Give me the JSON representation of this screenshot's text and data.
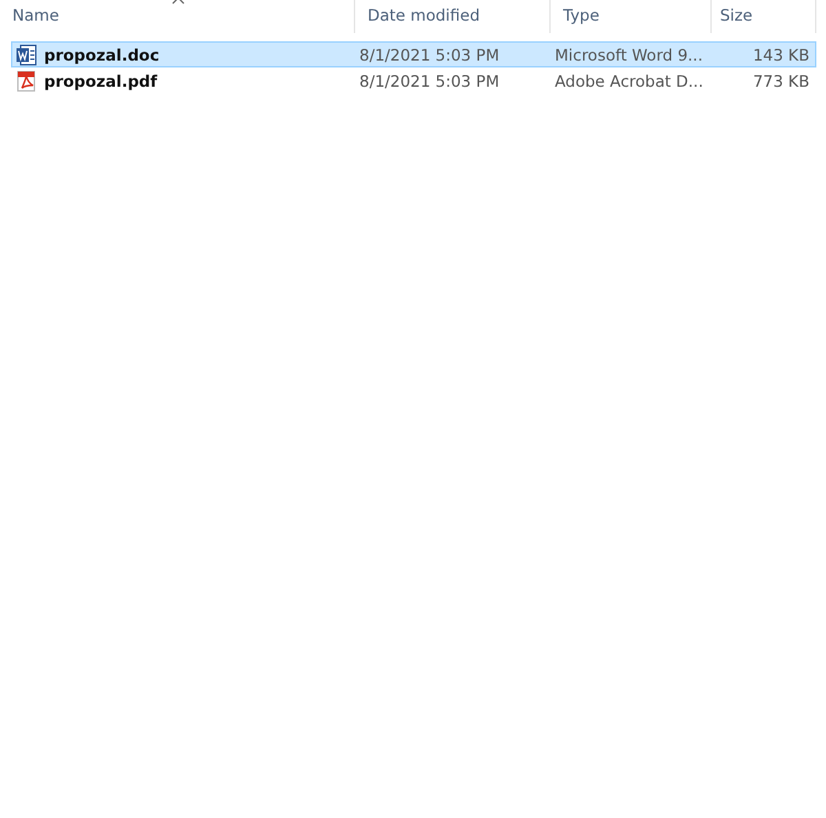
{
  "columns": [
    {
      "label": "Name",
      "sorted": true
    },
    {
      "label": "Date modified",
      "sorted": false
    },
    {
      "label": "Type",
      "sorted": false
    },
    {
      "label": "Size",
      "sorted": false
    }
  ],
  "files": [
    {
      "kind": "word",
      "name": "propozal.doc",
      "date": "8/1/2021 5:03 PM",
      "type": "Microsoft Word 9...",
      "size": "143 KB",
      "selected": true
    },
    {
      "kind": "pdf",
      "name": "propozal.pdf",
      "date": "8/1/2021 5:03 PM",
      "type": "Adobe Acrobat D...",
      "size": "773 KB",
      "selected": false
    }
  ]
}
